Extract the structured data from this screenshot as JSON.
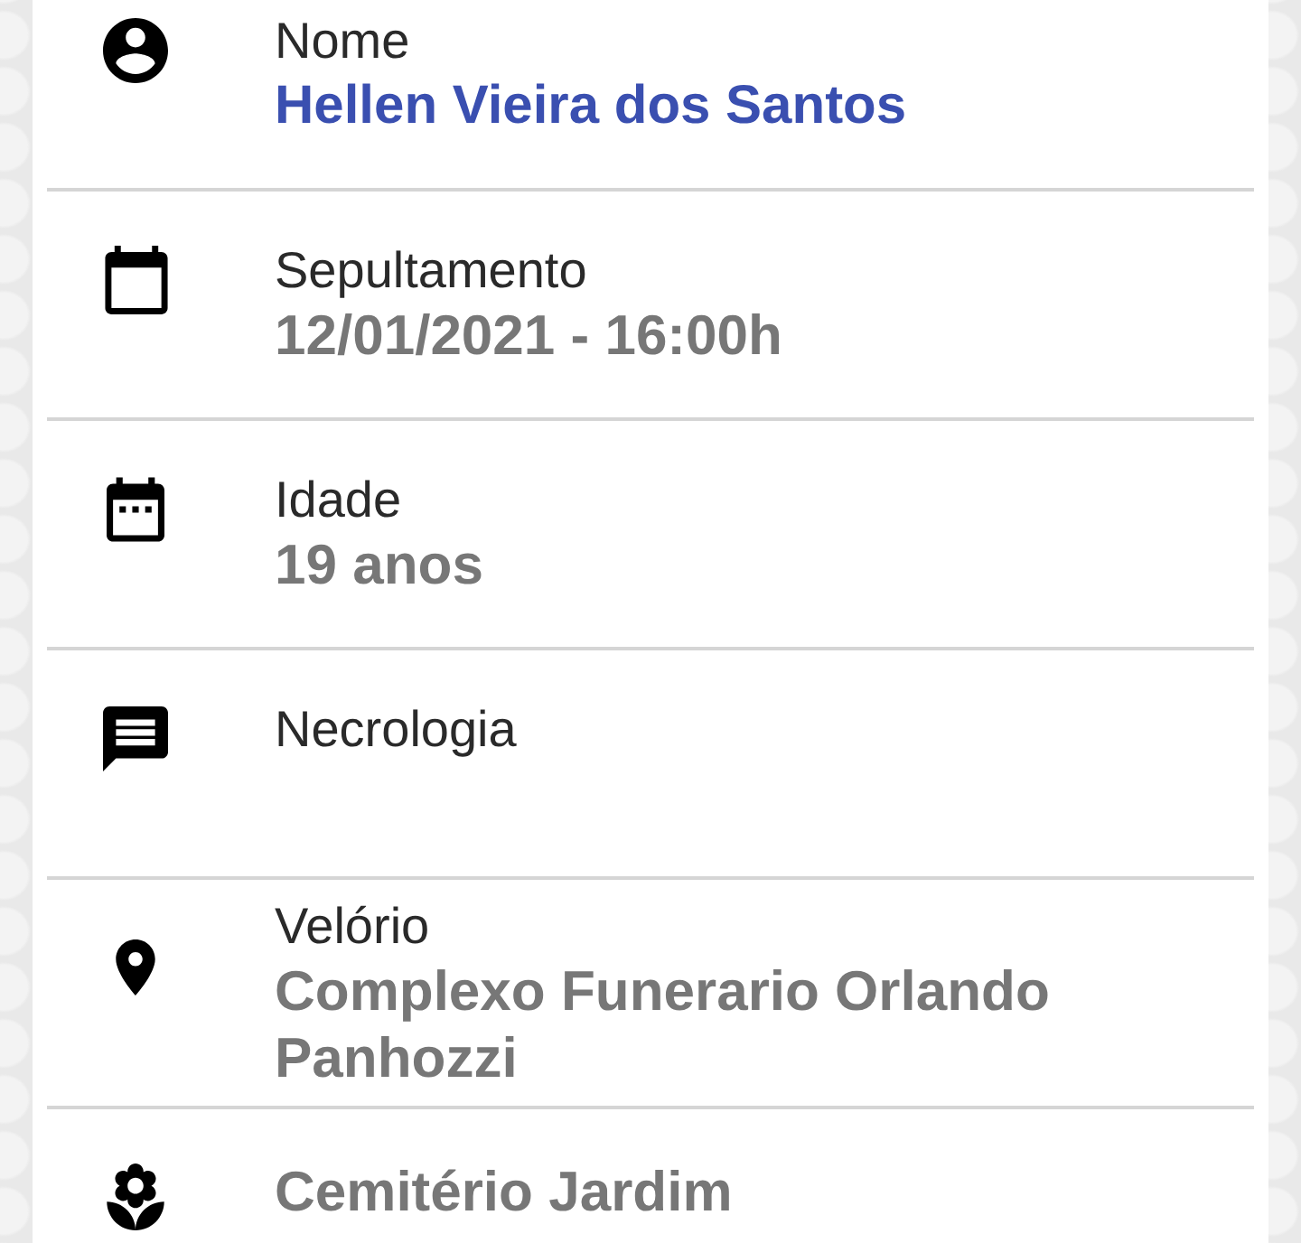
{
  "details": [
    {
      "label": "Nome",
      "value": "Hellen Vieira dos Santos",
      "kind": "highlighted"
    },
    {
      "label": "Sepultamento",
      "value": "12/01/2021 - 16:00h",
      "kind": "plain"
    },
    {
      "label": "Idade",
      "value": "19 anos",
      "kind": "plain"
    },
    {
      "label": "Necrologia"
    },
    {
      "label": "Velório",
      "value": "Complexo Funerario Orlando Panhozzi",
      "kind": "plain"
    },
    {
      "value": "Cemitério Jardim",
      "kind": "plain"
    }
  ]
}
